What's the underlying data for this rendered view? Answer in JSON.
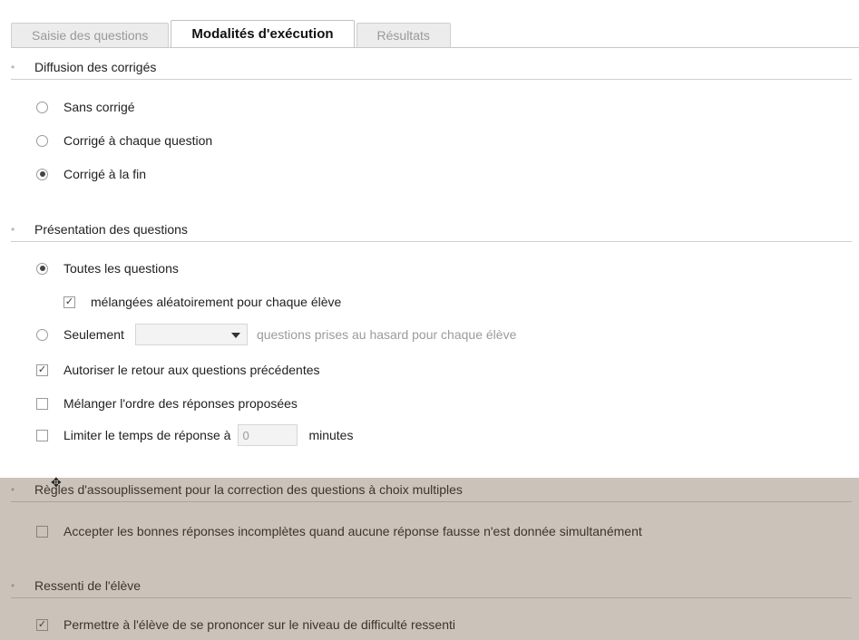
{
  "tabs": [
    {
      "label": "Saisie des questions",
      "active": false
    },
    {
      "label": "Modalités d'exécution",
      "active": true
    },
    {
      "label": "Résultats",
      "active": false
    }
  ],
  "sections": {
    "diffusion": {
      "title": "Diffusion des corrigés",
      "options": [
        {
          "label": "Sans corrigé",
          "selected": false
        },
        {
          "label": "Corrigé à chaque question",
          "selected": false
        },
        {
          "label": "Corrigé à la fin",
          "selected": true
        }
      ]
    },
    "presentation": {
      "title": "Présentation des questions",
      "toutes": {
        "label": "Toutes les questions",
        "selected": true
      },
      "melangees": {
        "label": "mélangées aléatoirement pour chaque élève",
        "checked": true
      },
      "seulement": {
        "label": "Seulement",
        "selected": false,
        "dropdown_value": "",
        "suffix": "questions prises au hasard pour chaque élève"
      },
      "retour": {
        "label": "Autoriser le retour aux questions précédentes",
        "checked": true
      },
      "melanger_reponses": {
        "label": "Mélanger l'ordre des réponses proposées",
        "checked": false
      },
      "limiter": {
        "label": "Limiter le temps de réponse à",
        "checked": false,
        "value": "0",
        "unit": "minutes"
      }
    },
    "regles": {
      "title": "Règles d'assouplissement pour la correction des questions à choix multiples",
      "accepter": {
        "label": "Accepter les bonnes réponses incomplètes quand aucune réponse fausse n'est donnée simultanément",
        "checked": false
      }
    },
    "ressenti": {
      "title": "Ressenti de l'élève",
      "permettre": {
        "label": "Permettre à l'élève de se prononcer sur le niveau de difficulté ressenti",
        "checked": true
      }
    }
  },
  "icons": {
    "radio": "radio-button-icon",
    "check": "checkbox-icon",
    "dropdown": "chevron-down-icon"
  },
  "colors": {
    "overlay": "#6e5a3c",
    "tab_active_text": "#111111",
    "tab_inactive_text": "#9a9a9a"
  }
}
